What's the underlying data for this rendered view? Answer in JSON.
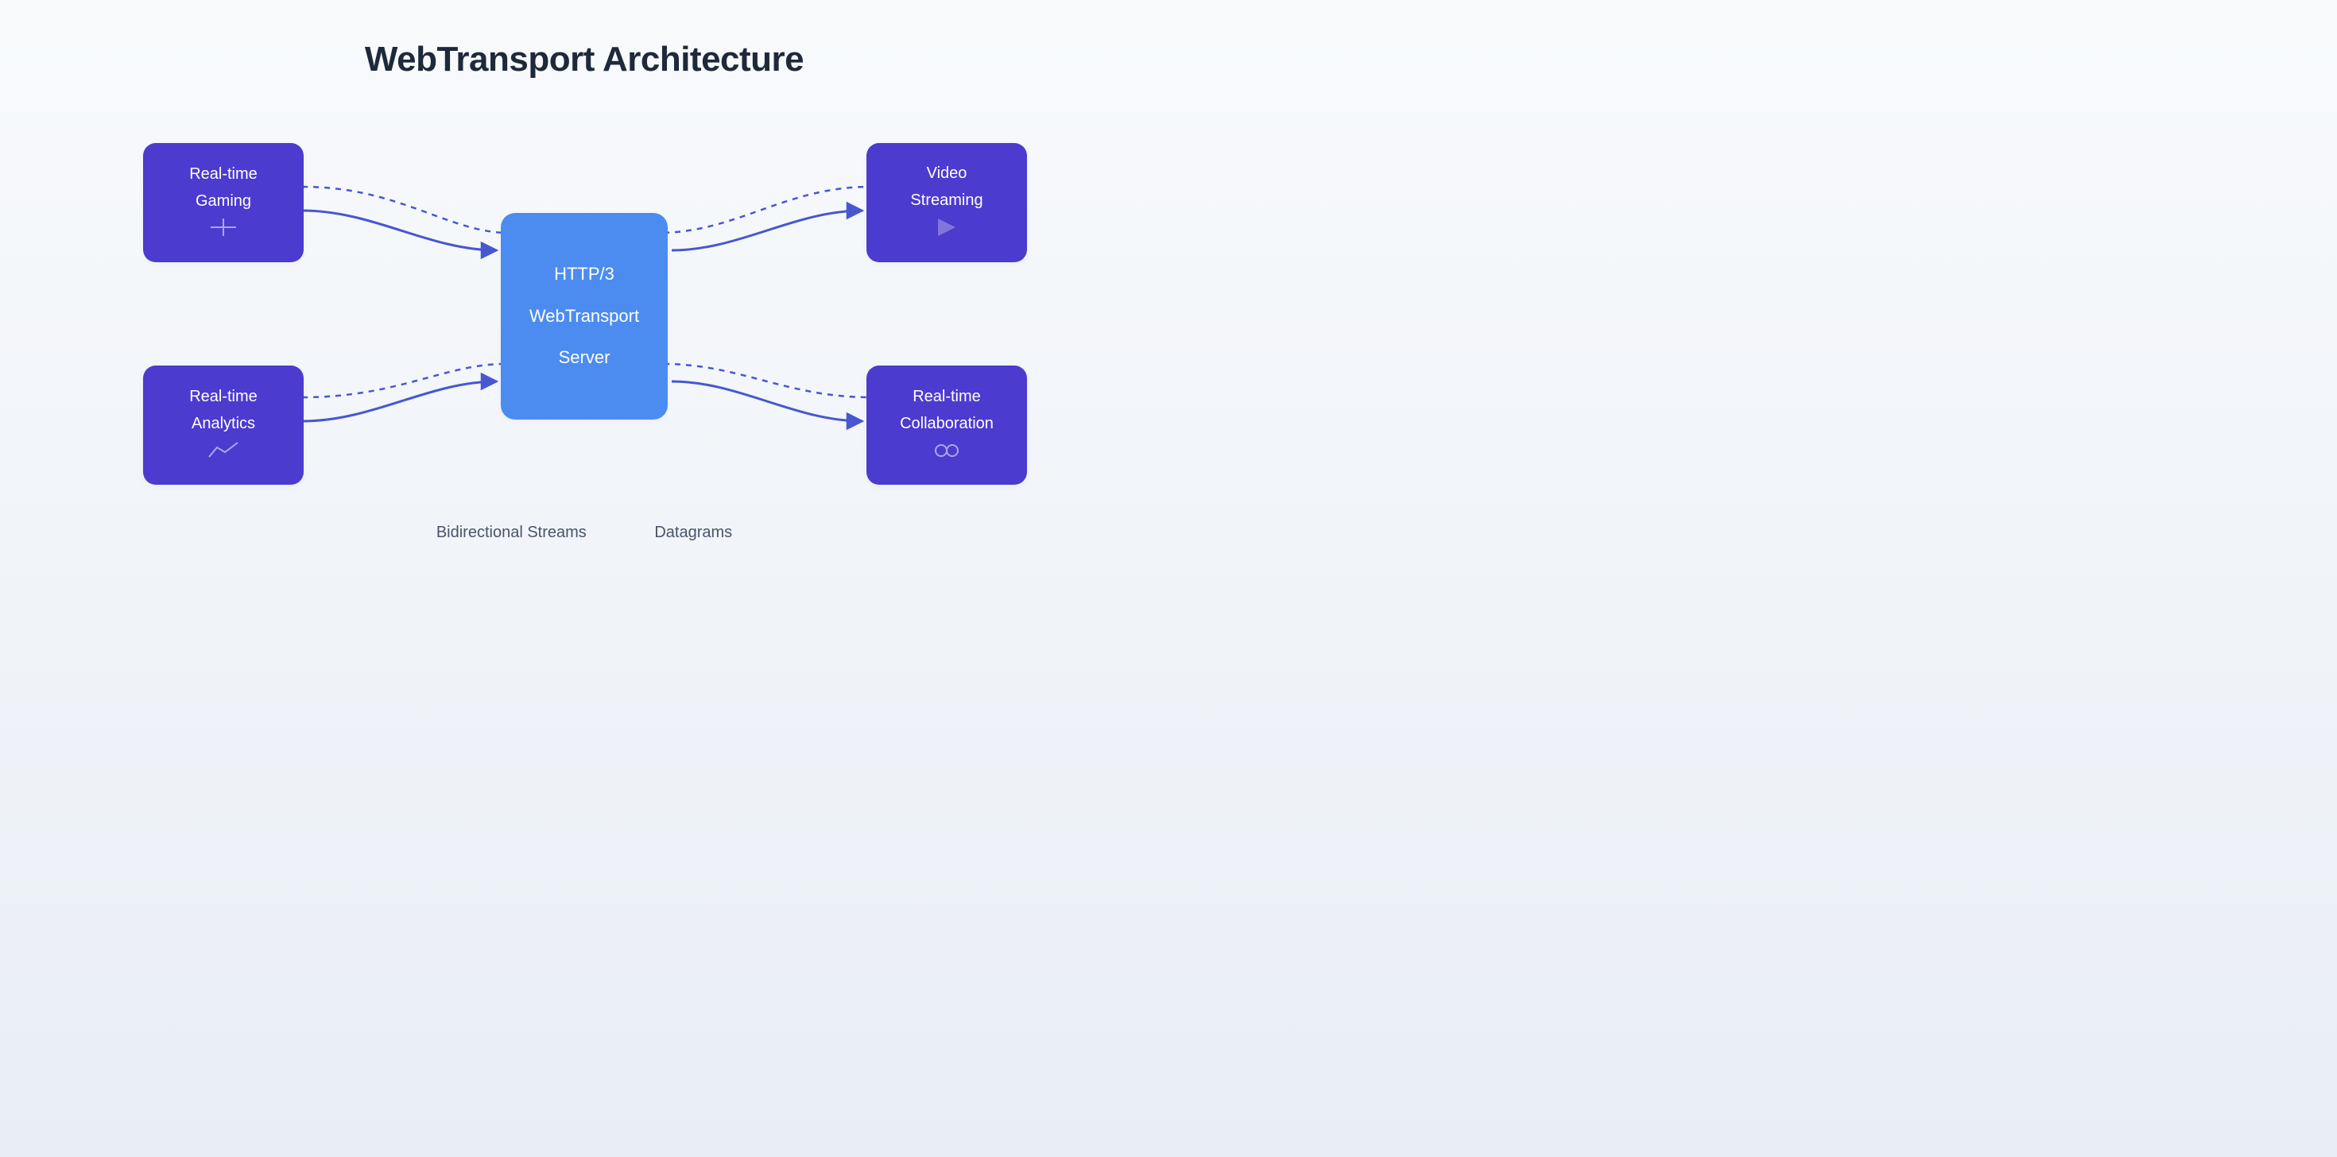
{
  "title": "WebTransport Architecture",
  "center": {
    "line1": "HTTP/3",
    "line2": "WebTransport",
    "line3": "Server"
  },
  "nodes": {
    "gaming": {
      "line1": "Real-time",
      "line2": "Gaming"
    },
    "analytics": {
      "line1": "Real-time",
      "line2": "Analytics"
    },
    "video": {
      "line1": "Video",
      "line2": "Streaming"
    },
    "collab": {
      "line1": "Real-time",
      "line2": "Collaboration"
    }
  },
  "legend": {
    "streams": "Bidirectional Streams",
    "datagrams": "Datagrams"
  },
  "colors": {
    "nodeFill": "#4c3bcf",
    "centerFill": "#4c8cf0",
    "stroke": "#4657d1"
  }
}
